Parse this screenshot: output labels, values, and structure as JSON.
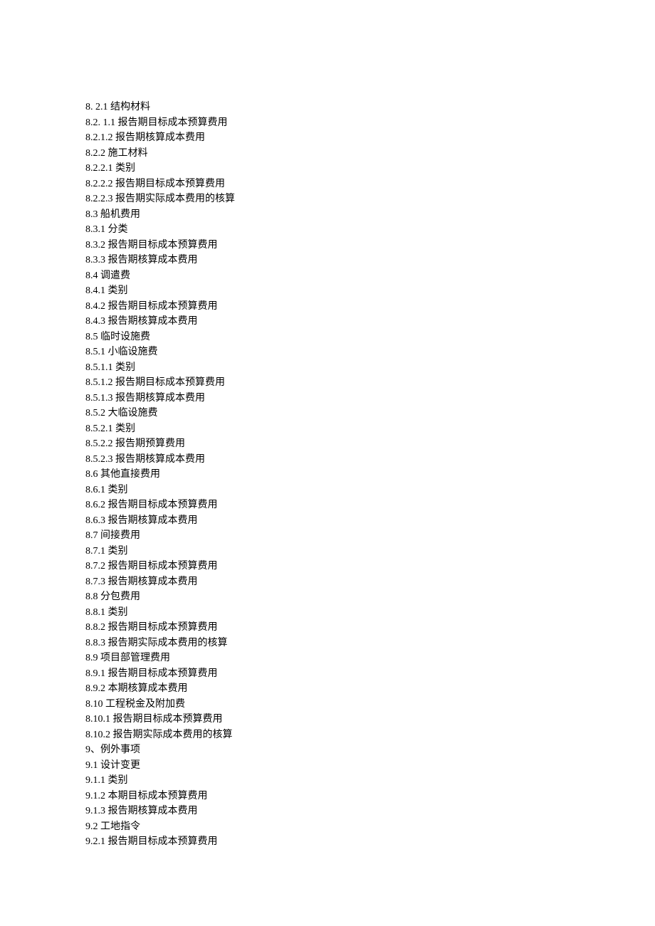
{
  "lines": [
    "8.   2.1 结构材料",
    "8.2.    1.1 报告期目标成本预算费用",
    "8.2.1.2 报告期核算成本费用",
    "8.2.2 施工材料",
    "8.2.2.1 类别",
    "8.2.2.2 报告期目标成本预算费用",
    "8.2.2.3 报告期实际成本费用的核算",
    "8.3 船机费用",
    "8.3.1 分类",
    "8.3.2 报告期目标成本预算费用",
    "8.3.3 报告期核算成本费用",
    "8.4 调遣费",
    "8.4.1 类别",
    "8.4.2 报告期目标成本预算费用",
    "8.4.3 报告期核算成本费用",
    "8.5 临时设施费",
    "8.5.1 小临设施费",
    "8.5.1.1 类别",
    "8.5.1.2 报告期目标成本预算费用",
    "8.5.1.3 报告期核算成本费用",
    "8.5.2 大临设施费",
    "8.5.2.1 类别",
    "8.5.2.2 报告期预算费用",
    "8.5.2.3 报告期核算成本费用",
    "8.6 其他直接费用",
    "8.6.1 类别",
    "8.6.2 报告期目标成本预算费用",
    "8.6.3 报告期核算成本费用",
    "8.7 间接费用",
    "8.7.1 类别",
    "8.7.2 报告期目标成本预算费用",
    "8.7.3 报告期核算成本费用",
    "8.8 分包费用",
    "8.8.1 类别",
    "8.8.2 报告期目标成本预算费用",
    "8.8.3 报告期实际成本费用的核算",
    "8.9 项目部管理费用",
    "8.9.1 报告期目标成本预算费用",
    "8.9.2 本期核算成本费用",
    "8.10 工程税金及附加费",
    "8.10.1 报告期目标成本预算费用",
    "8.10.2 报告期实际成本费用的核算",
    "9、例外事项",
    "9.1 设计变更",
    "9.1.1 类别",
    "9.1.2 本期目标成本预算费用",
    "9.1.3 报告期核算成本费用",
    "9.2 工地指令",
    "9.2.1 报告期目标成本预算费用"
  ]
}
